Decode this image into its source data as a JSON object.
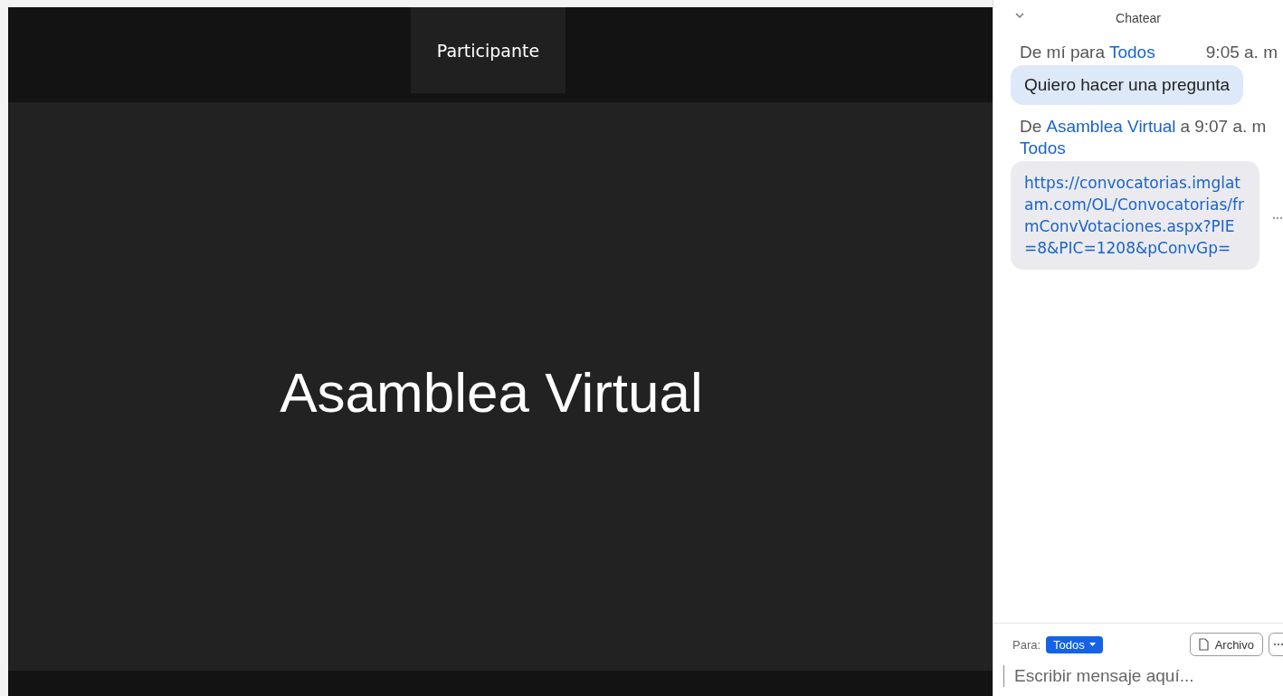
{
  "video": {
    "participant_label": "Participante",
    "speaker_name": "Asamblea Virtual"
  },
  "chat": {
    "title": "Chatear",
    "messages": [
      {
        "kind": "own",
        "prefix": "De mí para",
        "recipient": "Todos",
        "time": "9:05 a. m",
        "text": "Quiero hacer una pregunta"
      },
      {
        "kind": "received",
        "prefix": "De",
        "sender": "Asamblea Virtual",
        "connector": "a",
        "time": "9:07 a. m",
        "recipient": "Todos",
        "text": "https://convocatorias.imglatam.com/OL/Convocatorias/frmConvVotaciones.aspx?PIE=8&PIC=1208&pConvGp="
      }
    ],
    "to_label": "Para:",
    "to_value": "Todos",
    "file_button": "Archivo",
    "input": {
      "placeholder": "Escribir mensaje aquí..."
    }
  }
}
